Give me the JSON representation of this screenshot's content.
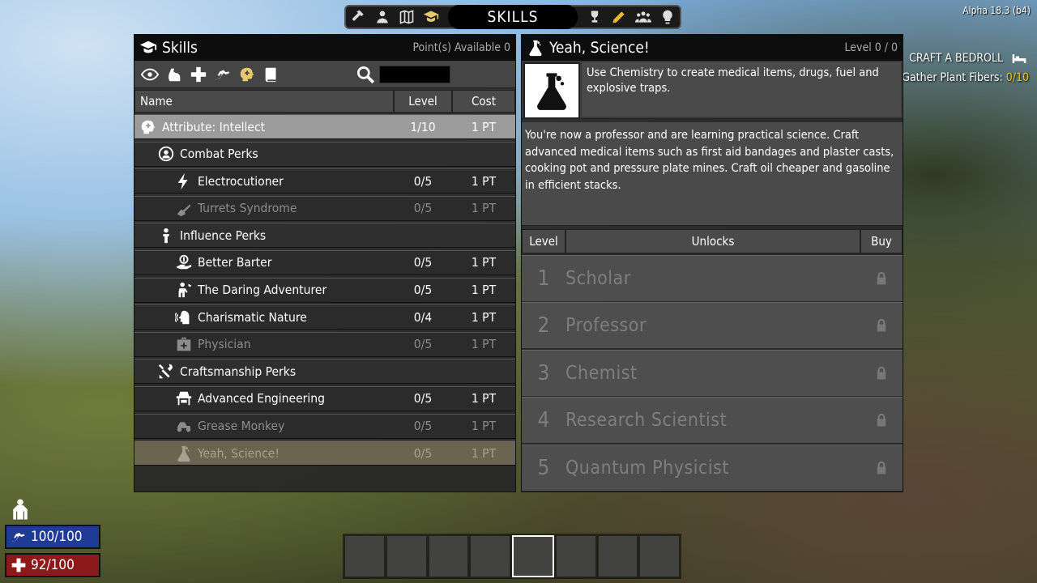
{
  "version": "Alpha 18.3 (b4)",
  "nav": {
    "title": "SKILLS",
    "left_icons": [
      "hammer-icon",
      "character-icon",
      "map-icon",
      "skills-icon"
    ],
    "right_icons": [
      "trophy-icon",
      "pencil-icon",
      "players-icon",
      "idea-icon"
    ]
  },
  "quest": {
    "title": "CRAFT A BEDROLL",
    "objective_label": "Gather Plant Fibers:",
    "objective_progress": "0/10"
  },
  "skills_panel": {
    "title": "Skills",
    "points": "Point(s) Available 0",
    "categories": [
      "eye-icon",
      "strength-icon",
      "medical-cross-icon",
      "running-icon",
      "brain-icon",
      "book-icon"
    ],
    "search_value": "",
    "columns": {
      "name": "Name",
      "level": "Level",
      "cost": "Cost"
    },
    "rows": [
      {
        "kind": "attr",
        "name": "Attribute: Intellect",
        "level": "1/10",
        "cost": "1 PT",
        "icon": "brain-icon"
      },
      {
        "kind": "group",
        "name": "Combat Perks",
        "level": "",
        "cost": "",
        "icon": "combat-icon"
      },
      {
        "kind": "perk",
        "name": "Electrocutioner",
        "level": "0/5",
        "cost": "1 PT",
        "icon": "lightning-icon"
      },
      {
        "kind": "perk locked",
        "name": "Turrets Syndrome",
        "level": "0/5",
        "cost": "1 PT",
        "icon": "turret-icon"
      },
      {
        "kind": "group",
        "name": "Influence Perks",
        "level": "",
        "cost": "",
        "icon": "influence-icon"
      },
      {
        "kind": "perk",
        "name": "Better Barter",
        "level": "0/5",
        "cost": "1 PT",
        "icon": "barter-icon"
      },
      {
        "kind": "perk",
        "name": "The Daring Adventurer",
        "level": "0/5",
        "cost": "1 PT",
        "icon": "adventurer-icon"
      },
      {
        "kind": "perk",
        "name": "Charismatic Nature",
        "level": "0/4",
        "cost": "1 PT",
        "icon": "charisma-icon"
      },
      {
        "kind": "perk locked",
        "name": "Physician",
        "level": "0/5",
        "cost": "1 PT",
        "icon": "medkit-icon"
      },
      {
        "kind": "group",
        "name": "Craftsmanship Perks",
        "level": "",
        "cost": "",
        "icon": "tools-icon"
      },
      {
        "kind": "perk",
        "name": "Advanced Engineering",
        "level": "0/5",
        "cost": "1 PT",
        "icon": "workbench-icon"
      },
      {
        "kind": "perk locked",
        "name": "Grease Monkey",
        "level": "0/5",
        "cost": "1 PT",
        "icon": "vehicle-icon"
      },
      {
        "kind": "perk selected",
        "name": "Yeah, Science!",
        "level": "0/5",
        "cost": "1 PT",
        "icon": "flask-icon"
      }
    ]
  },
  "detail_panel": {
    "title": "Yeah, Science!",
    "level": "Level 0 / 0",
    "short_description": "Use Chemistry to create medical items, drugs, fuel and explosive traps.",
    "long_description": "You're now a professor and are learning practical science. Craft advanced medical items such as first aid bandages and plaster casts, cooking pot and pressure plate mines. Craft oil cheaper and gasoline in efficient stacks.",
    "unlocks_columns": {
      "level": "Level",
      "unlocks": "Unlocks",
      "buy": "Buy"
    },
    "unlocks": [
      {
        "num": "1",
        "name": "Scholar"
      },
      {
        "num": "2",
        "name": "Professor"
      },
      {
        "num": "3",
        "name": "Chemist"
      },
      {
        "num": "4",
        "name": "Research Scientist"
      },
      {
        "num": "5",
        "name": "Quantum Physicist"
      }
    ]
  },
  "hud": {
    "stamina": "100/100",
    "health": "92/100",
    "toolbelt_slots": 8,
    "active_slot": 4
  },
  "colors": {
    "stamina": "#1e3c96",
    "health": "#8c1a1a",
    "selected_row": "#6b6450",
    "quest_progress": "#f0c020"
  }
}
